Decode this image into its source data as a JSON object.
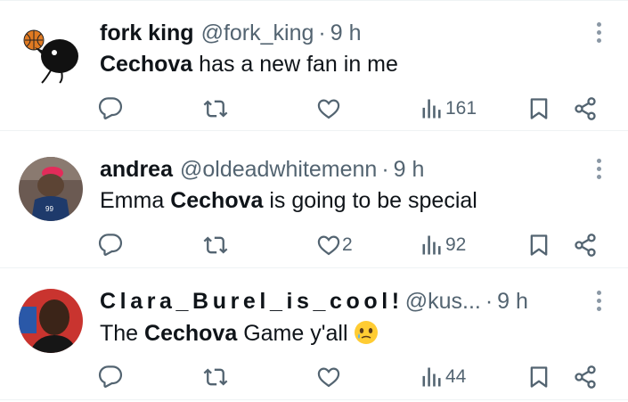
{
  "tweets": [
    {
      "display_name": "fork king",
      "handle": "@fork_king",
      "separator": "·",
      "time": "9 h",
      "text_before": "",
      "text_bold": "Cechova",
      "text_after": " has a new fan in me",
      "replies": "",
      "retweets": "",
      "likes": "",
      "views": "161",
      "avatar_icon": "basketball-bird-avatar"
    },
    {
      "display_name": "andrea",
      "handle": "@oldeadwhitemenn",
      "separator": "·",
      "time": "9 h",
      "text_before": "Emma ",
      "text_bold": "Cechova",
      "text_after": " is going to be special",
      "replies": "",
      "retweets": "",
      "likes": "2",
      "views": "92",
      "avatar_icon": "mascot-avatar"
    },
    {
      "display_name": "Clara_Burel_is_cool!",
      "handle": "@kus...",
      "separator": "·",
      "time": "9 h",
      "text_before": "The ",
      "text_bold": "Cechova",
      "text_after": " Game y'all",
      "emoji": "face-holding-back-tears",
      "replies": "",
      "retweets": "",
      "likes": "",
      "views": "44",
      "avatar_icon": "player-photo-avatar"
    }
  ],
  "colors": {
    "text": "#0f1419",
    "secondary": "#536471",
    "divider": "#eff3f4"
  },
  "icons": [
    "reply-icon",
    "retweet-icon",
    "like-icon",
    "views-icon",
    "bookmark-icon",
    "share-icon",
    "more-icon"
  ]
}
